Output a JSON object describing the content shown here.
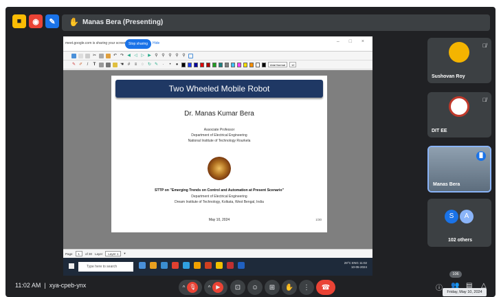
{
  "top_icons": [
    {
      "name": "activities-icon",
      "color": "#fbbc04",
      "glyph": "■"
    },
    {
      "name": "record-icon",
      "color": "#ea4335",
      "glyph": "◉"
    },
    {
      "name": "transcript-icon",
      "color": "#1a73e8",
      "glyph": "✎"
    }
  ],
  "presenter": {
    "label": "Manas Bera (Presenting)"
  },
  "share_bar": {
    "message": "meet.google.com is sharing your screen.",
    "stop_label": "Stop sharing",
    "hide_label": "Hide",
    "window_controls": "– □ ×"
  },
  "slide": {
    "title": "Two Wheeled Mobile Robot",
    "author": "Dr. Manas Kumar Bera",
    "affiliation": [
      "Associate Professor",
      "Department of Electrical Engineering",
      "National Institute of Technology Rourkela"
    ],
    "event": "STTP on \"Emerging Trends on Control and Automation at Present Scenario\"",
    "event_affiliation": [
      "Department of Electrical Engineering",
      "Dream Institute of Technology, Kolkata, West Bengal, India"
    ],
    "date": "May 10, 2024",
    "page": "1/30"
  },
  "editor_toolbar": {
    "font": "Arial Normal",
    "size": "12"
  },
  "status_bar": {
    "page_label": "Page",
    "page_value": "1",
    "page_total": "of 30",
    "layer_label": "Layer",
    "layer_value": "Layer 1"
  },
  "taskbar": {
    "search_placeholder": "Type here to search",
    "weather": "29°C",
    "lang": "ENG",
    "time": "11:02",
    "date": "10-05-2024"
  },
  "participants": [
    {
      "name": "Sushovan Roy",
      "muted": true
    },
    {
      "name": "DIT EE",
      "muted": true
    },
    {
      "name": "Manas Bera",
      "speaking": true
    },
    {
      "name": "102 others",
      "initials": [
        "S",
        "A"
      ]
    }
  ],
  "bottom_bar": {
    "time": "11:02 AM",
    "meeting_code": "xya-cpeb-ynx",
    "people_count": "106",
    "tooltip": "Friday, May 10, 2024"
  },
  "colors": {
    "meet_bg": "#202124",
    "tile_bg": "#3c4043",
    "end_call": "#ea4335",
    "slide_title_bg": "#1f3864",
    "accent": "#1a73e8"
  }
}
